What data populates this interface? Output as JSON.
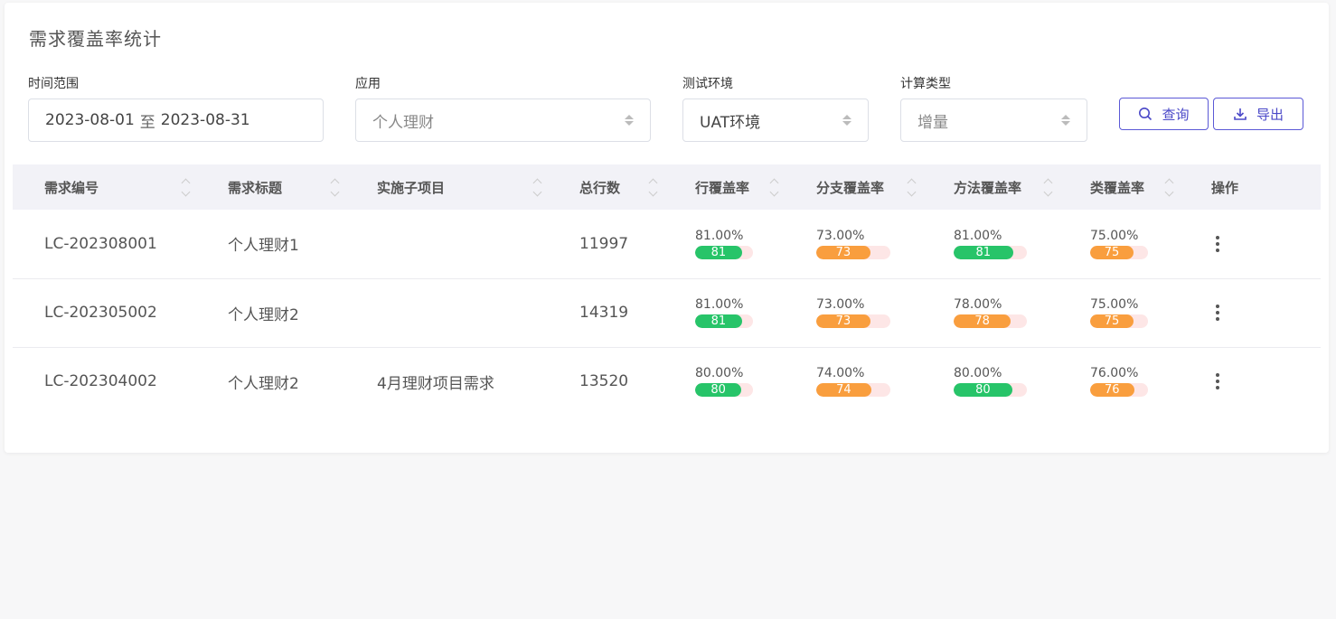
{
  "page": {
    "title": "需求覆盖率统计"
  },
  "filters": {
    "time_range": {
      "label": "时间范围",
      "start": "2023-08-01",
      "separator": "至",
      "end": "2023-08-31"
    },
    "app": {
      "label": "应用",
      "value": "个人理财"
    },
    "env": {
      "label": "测试环境",
      "value": "UAT环境"
    },
    "calc_type": {
      "label": "计算类型",
      "value": "增量"
    }
  },
  "buttons": {
    "query": "查询",
    "export": "导出"
  },
  "icons": {
    "query": "search-icon",
    "export": "download-icon",
    "actions": "more-vertical-icon"
  },
  "table": {
    "headers": [
      "需求编号",
      "需求标题",
      "实施子项目",
      "总行数",
      "行覆盖率",
      "分支覆盖率",
      "方法覆盖率",
      "类覆盖率",
      "操作"
    ],
    "rows": [
      {
        "id": "LC-202308001",
        "title": "个人理财1",
        "subproject": "",
        "lines": "11997",
        "line_cov": {
          "pct": "81.00%",
          "val": "81"
        },
        "branch_cov": {
          "pct": "73.00%",
          "val": "73"
        },
        "method_cov": {
          "pct": "81.00%",
          "val": "81"
        },
        "class_cov": {
          "pct": "75.00%",
          "val": "75"
        }
      },
      {
        "id": "LC-202305002",
        "title": "个人理财2",
        "subproject": "",
        "lines": "14319",
        "line_cov": {
          "pct": "81.00%",
          "val": "81"
        },
        "branch_cov": {
          "pct": "73.00%",
          "val": "73"
        },
        "method_cov": {
          "pct": "78.00%",
          "val": "78"
        },
        "class_cov": {
          "pct": "75.00%",
          "val": "75"
        }
      },
      {
        "id": "LC-202304002",
        "title": "个人理财2",
        "subproject": "4月理财项目需求",
        "lines": "13520",
        "line_cov": {
          "pct": "80.00%",
          "val": "80"
        },
        "branch_cov": {
          "pct": "74.00%",
          "val": "74"
        },
        "method_cov": {
          "pct": "80.00%",
          "val": "80"
        },
        "class_cov": {
          "pct": "76.00%",
          "val": "76"
        }
      }
    ]
  },
  "colors": {
    "accent": "#5b59d6",
    "good": "#27c469",
    "warn": "#f99e3e",
    "track": "#fde6e6"
  }
}
